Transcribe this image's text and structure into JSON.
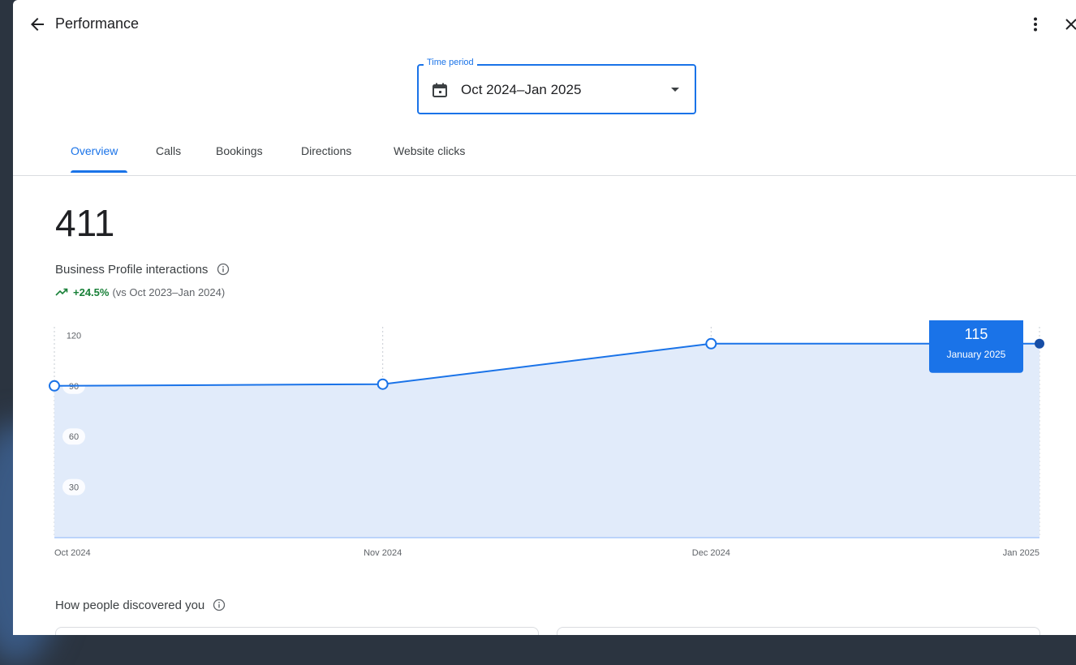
{
  "header": {
    "title": "Performance",
    "back_icon": "arrow-back-icon",
    "more_icon": "more-vert-icon",
    "close_icon": "close-icon"
  },
  "time_period": {
    "legend": "Time period",
    "value": "Oct 2024–Jan 2025",
    "icon": "calendar-icon"
  },
  "tabs": [
    {
      "label": "Overview",
      "active": true
    },
    {
      "label": "Calls",
      "active": false
    },
    {
      "label": "Bookings",
      "active": false
    },
    {
      "label": "Directions",
      "active": false
    },
    {
      "label": "Website clicks",
      "active": false
    }
  ],
  "summary": {
    "total": "411",
    "label": "Business Profile interactions",
    "trend_pct": "+24.5%",
    "trend_comparison": "(vs Oct 2023–Jan 2024)",
    "trend_icon": "trending-up-icon"
  },
  "chart_data": {
    "type": "area",
    "x": [
      "Oct 2024",
      "Nov 2024",
      "Dec 2024",
      "Jan 2025"
    ],
    "values": [
      90,
      91,
      115,
      115
    ],
    "yticks": [
      120,
      90,
      60,
      30
    ],
    "ylim": [
      0,
      125
    ],
    "tooltip": {
      "value": "115",
      "label": "January 2025"
    },
    "grid": "vertical-dotted",
    "colors": {
      "line": "#1a73e8",
      "fill": "#e1ebfa",
      "tooltip": "#1a73e8"
    }
  },
  "discover": {
    "label": "How people discovered you"
  },
  "colors": {
    "accent": "#1a73e8",
    "positive": "#188038",
    "text": "#202124",
    "muted": "#5f6368"
  }
}
